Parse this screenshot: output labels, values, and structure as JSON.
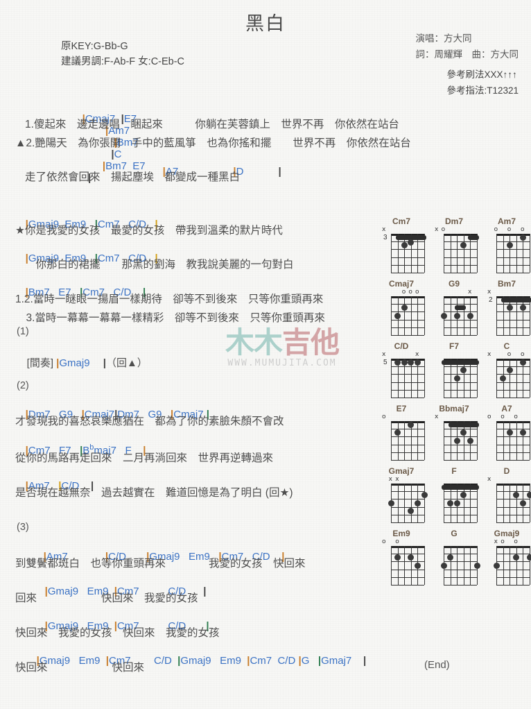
{
  "song": {
    "title": "黑白",
    "original_key": "原KEY:G-Bb-G",
    "suggested_key": "建議男調:F-Ab-F 女:C-Eb-C",
    "singer": "演唱：方大同",
    "credits": "詞：周耀輝　曲：方大同",
    "strum": "參考刷法XXX↑↑↑",
    "fingerstyle": "參考指法:T12321",
    "end_mark": "(End)"
  },
  "watermark": {
    "line1_a": "木木",
    "line1_b": "吉他",
    "url": "WWW.MUMUJITA.COM"
  },
  "sections": [
    {
      "label": "(1)",
      "interlude_tag": "[間奏]",
      "interlude_chord": "Gmaj9",
      "interlude_repeat": "（回▲）"
    },
    {
      "label": "(2)"
    },
    {
      "label": "(3)"
    }
  ],
  "lines": {
    "v1_chords": "|Cmaj7  |E7         |Am7            |Bm7            |C        |Bm7   E7   |",
    "v1_lyric_a": "1.傻起來　邊走邊唱　睏起來　　　你躺在芙蓉鎮上　世界不再　你依然在站台",
    "v1_lyric_b": "▲2.艷陽天　為你張開　手中的藍風箏　也為你搖和擺　　世界不再　你依然在站台",
    "v1_chords2": "|A7                     |D              |",
    "v1_lyric_c": "走了依然會回來　揚起塵埃　都變成一種黑白",
    "ch_chords1": "|Gmaj9  Em9   |Cm7   C/D    |",
    "ch_lyric1": "★你是我愛的女孩　最愛的女孩　帶我到溫柔的默片時代",
    "ch_chords2": "|Gmaj9  Em9   |Cm7   C/D    |",
    "ch_lyric2": "　你那白的裙擺　　那黑的劉海　教我說美麗的一句對白",
    "ch_chords3": "|Bm7   E7   |Cm7   C/D    |",
    "ch_lyric3": "1.2.當時一瞇眼一揚眉一樣期待　卻等不到後來　只等你重頭再來",
    "ch_lyric4": "　3.當時一幕幕一幕幕一樣精彩　卻等不到後來　只等你重頭再來",
    "s2_chords1": "|Dm7   G9   |Cmaj7|Dm7   G9   |Cmaj7 |",
    "s2_lyric1": "才發現我的喜怒哀樂應猶在　都為了你的素臉朱顏不會改",
    "s2_chords2": "|Cm7   F7   |B♭maj7   F    |",
    "s2_lyric2": "從你的馬路再走回來　二月再淌回來　世界再逆轉過來",
    "s2_chords3": "|Am7   |C/D    |",
    "s2_lyric3": "是否現在越無奈　過去越實在　難道回憶是為了明白 (回★)",
    "s3_chords1": "|Am7            |C/D        |Gmaj9   Em9   |Cm7   C/D    |",
    "s3_lyric1": "到雙鬢都斑白　也等你重頭再來　　　　我愛的女孩　快回來",
    "s3_chords2": "|Gmaj9   Em9   |Cm7          C/D      |",
    "s3_lyric2": "回來　　　　　　快回來　我愛的女孩",
    "s3_chords3": "|Gmaj9   Em9   |Cm7          C/D       |",
    "s3_lyric3": "快回來　我愛的女孩　快回來　我愛的女孩",
    "s3_chords4": "|Gmaj9   Em9   |Cm7        C/D   |Gmaj9   Em9   |Cm7   C/D  |G    |Gmaj7    |",
    "s3_lyric4": "快回來　　　　　　快回來"
  },
  "chord_diagrams": [
    [
      {
        "name": "Cm7",
        "pos": "3",
        "marks": [
          {
            "t": "x",
            "s": 6
          }
        ],
        "barres": [
          {
            "fret": 1,
            "from": 5,
            "to": 1
          }
        ],
        "dots": [
          {
            "s": 4,
            "f": 2
          },
          {
            "s": 3,
            "f": 1.6
          }
        ]
      },
      {
        "name": "Dm7",
        "pos": "",
        "marks": [
          {
            "t": "x",
            "s": 6
          },
          {
            "t": "o",
            "s": 5
          }
        ],
        "barres": [
          {
            "fret": 1,
            "from": 2,
            "to": 1
          }
        ],
        "dots": [
          {
            "s": 3,
            "f": 2
          }
        ]
      },
      {
        "name": "Am7",
        "pos": "",
        "marks": [
          {
            "t": "o",
            "s": 5
          },
          {
            "t": "o",
            "s": 3
          },
          {
            "t": "o",
            "s": 1
          }
        ],
        "barres": [],
        "dots": [
          {
            "s": 4,
            "f": 2
          },
          {
            "s": 2,
            "f": 1
          }
        ]
      }
    ],
    [
      {
        "name": "Cmaj7",
        "pos": "",
        "marks": [
          {
            "t": "o",
            "s": 3
          },
          {
            "t": "o",
            "s": 2
          },
          {
            "t": "o",
            "s": 1
          }
        ],
        "barres": [],
        "dots": [
          {
            "s": 4,
            "f": 2
          },
          {
            "s": 5,
            "f": 3
          }
        ]
      },
      {
        "name": "G9",
        "pos": "",
        "marks": [
          {
            "t": "x",
            "s": 1
          }
        ],
        "barres": [
          {
            "fret": 2,
            "from": 4,
            "to": 3
          }
        ],
        "dots": [
          {
            "s": 6,
            "f": 3
          },
          {
            "s": 4,
            "f": 3
          },
          {
            "s": 2,
            "f": 3
          }
        ]
      },
      {
        "name": "Bm7",
        "pos": "2",
        "marks": [
          {
            "t": "x",
            "s": 6
          }
        ],
        "barres": [
          {
            "fret": 1,
            "from": 5,
            "to": 1
          }
        ],
        "dots": [
          {
            "s": 4,
            "f": 2
          },
          {
            "s": 2,
            "f": 2
          }
        ]
      }
    ],
    [
      {
        "name": "C/D",
        "pos": "5",
        "marks": [
          {
            "t": "x",
            "s": 6
          },
          {
            "t": "x",
            "s": 1
          }
        ],
        "barres": [],
        "dots": [
          {
            "s": 5,
            "f": 1
          },
          {
            "s": 4,
            "f": 1
          },
          {
            "s": 3,
            "f": 1
          },
          {
            "s": 2,
            "f": 1
          }
        ]
      },
      {
        "name": "F7",
        "pos": "",
        "marks": [],
        "barres": [
          {
            "fret": 1,
            "from": 6,
            "to": 1
          }
        ],
        "dots": [
          {
            "s": 4,
            "f": 3
          },
          {
            "s": 3,
            "f": 2
          }
        ]
      },
      {
        "name": "C",
        "pos": "",
        "marks": [
          {
            "t": "x",
            "s": 6
          },
          {
            "t": "o",
            "s": 3
          },
          {
            "t": "o",
            "s": 1
          }
        ],
        "barres": [],
        "dots": [
          {
            "s": 5,
            "f": 3
          },
          {
            "s": 4,
            "f": 2
          },
          {
            "s": 2,
            "f": 1
          }
        ]
      }
    ],
    [
      {
        "name": "E7",
        "pos": "",
        "marks": [
          {
            "t": "o",
            "s": 6
          }
        ],
        "barres": [],
        "dots": [
          {
            "s": 5,
            "f": 2
          },
          {
            "s": 3,
            "f": 1
          }
        ]
      },
      {
        "name": "Bbmaj7",
        "pos": "",
        "marks": [
          {
            "t": "x",
            "s": 6
          }
        ],
        "barres": [
          {
            "fret": 1,
            "from": 5,
            "to": 1
          }
        ],
        "dots": [
          {
            "s": 3,
            "f": 2
          },
          {
            "s": 4,
            "f": 3
          },
          {
            "s": 2,
            "f": 3
          }
        ]
      },
      {
        "name": "A7",
        "pos": "",
        "marks": [
          {
            "t": "o",
            "s": 6
          },
          {
            "t": "o",
            "s": 4
          },
          {
            "t": "o",
            "s": 2
          }
        ],
        "barres": [],
        "dots": [
          {
            "s": 4,
            "f": 2
          },
          {
            "s": 2,
            "f": 2
          }
        ]
      }
    ],
    [
      {
        "name": "Gmaj7",
        "pos": "",
        "marks": [
          {
            "t": "x",
            "s": 5
          },
          {
            "t": "x",
            "s": 4
          }
        ],
        "barres": [],
        "dots": [
          {
            "s": 6,
            "f": 3
          },
          {
            "s": 1,
            "f": 2
          },
          {
            "s": 2,
            "f": 3
          },
          {
            "s": 3,
            "f": 4
          }
        ]
      },
      {
        "name": "F",
        "pos": "",
        "marks": [],
        "barres": [
          {
            "fret": 1,
            "from": 6,
            "to": 1
          }
        ],
        "dots": [
          {
            "s": 5,
            "f": 3
          },
          {
            "s": 4,
            "f": 3
          },
          {
            "s": 3,
            "f": 2
          }
        ]
      },
      {
        "name": "D",
        "pos": "",
        "marks": [
          {
            "t": "x",
            "s": 6
          }
        ],
        "barres": [],
        "dots": [
          {
            "s": 3,
            "f": 2
          },
          {
            "s": 1,
            "f": 2
          },
          {
            "s": 2,
            "f": 3
          }
        ]
      }
    ],
    [
      {
        "name": "Em9",
        "pos": "",
        "marks": [
          {
            "t": "o",
            "s": 6
          },
          {
            "t": "o",
            "s": 4
          }
        ],
        "barres": [],
        "dots": [
          {
            "s": 5,
            "f": 2
          },
          {
            "s": 2,
            "f": 3
          },
          {
            "s": 3,
            "f": 2
          }
        ]
      },
      {
        "name": "G",
        "pos": "",
        "marks": [],
        "barres": [],
        "dots": [
          {
            "s": 6,
            "f": 3
          },
          {
            "s": 5,
            "f": 2
          },
          {
            "s": 1,
            "f": 3
          }
        ]
      },
      {
        "name": "Gmaj9",
        "pos": "",
        "marks": [
          {
            "t": "x",
            "s": 5
          },
          {
            "t": "o",
            "s": 4
          },
          {
            "t": "o",
            "s": 2
          }
        ],
        "barres": [],
        "dots": [
          {
            "s": 6,
            "f": 3
          },
          {
            "s": 3,
            "f": 2
          },
          {
            "s": 1,
            "f": 2
          }
        ]
      }
    ]
  ]
}
